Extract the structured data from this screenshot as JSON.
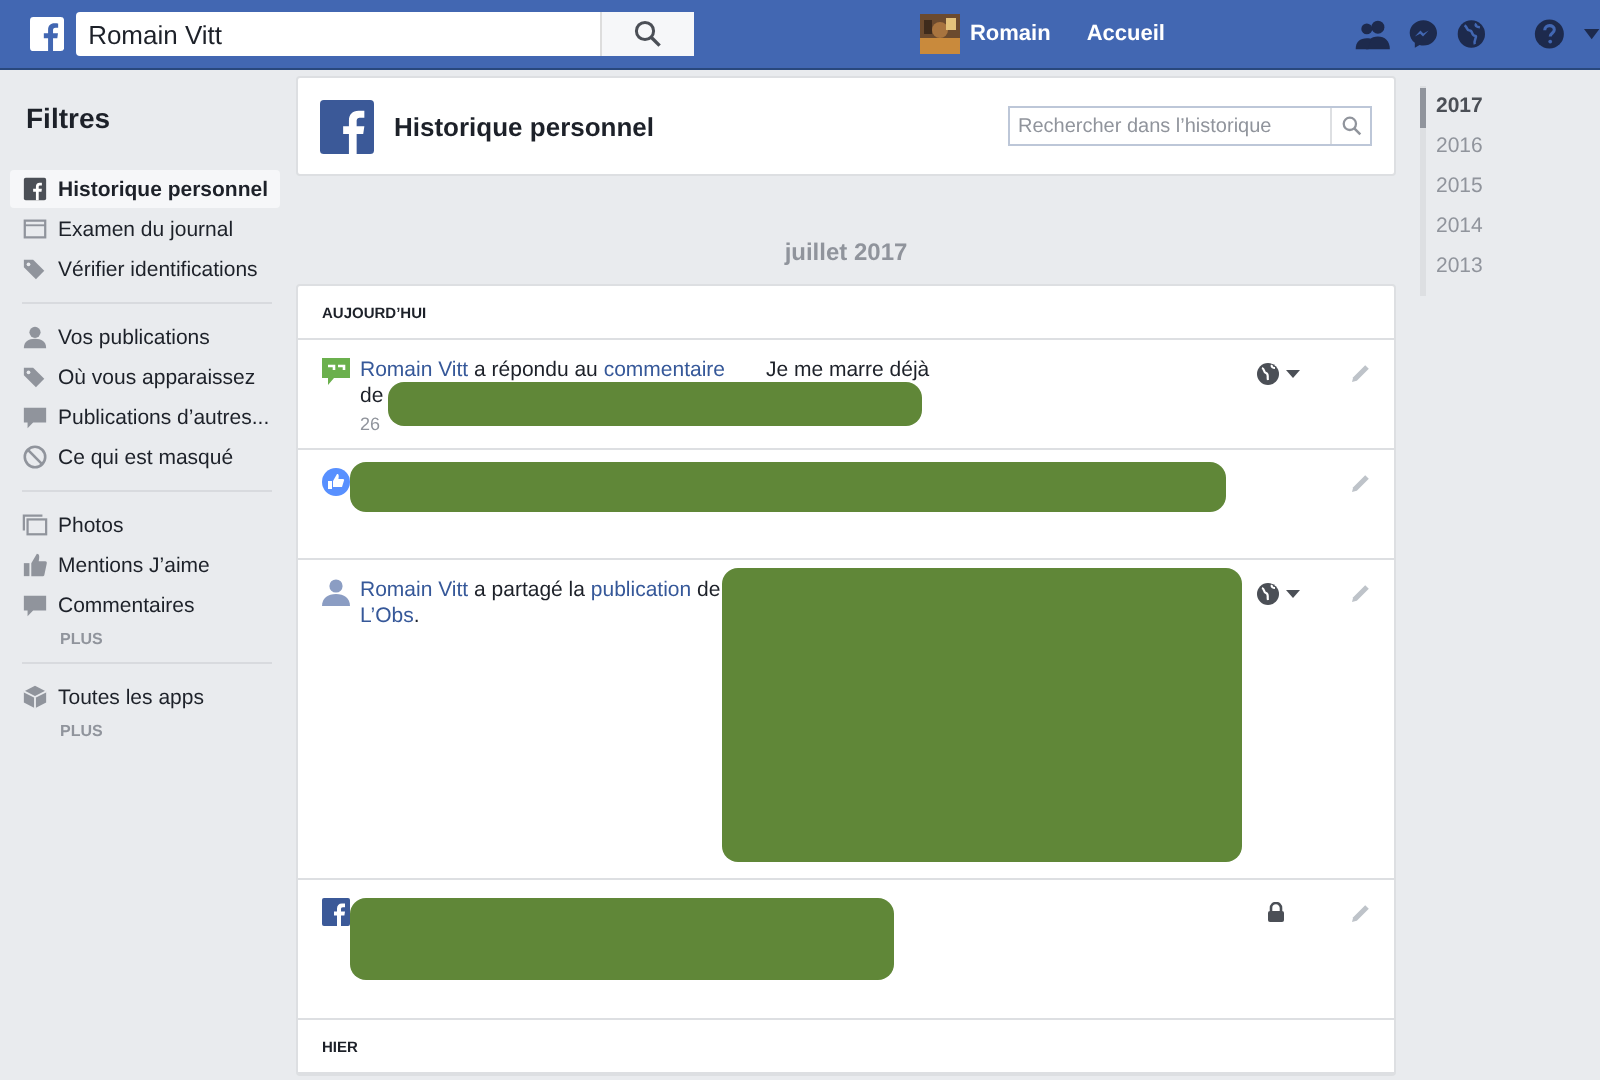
{
  "top_bar": {
    "search": {
      "value": "Romain Vitt"
    },
    "profile_name": "Romain",
    "home_link": "Accueil"
  },
  "sidebar": {
    "title": "Filtres",
    "groups": [
      {
        "items": [
          {
            "label": "Historique personnel",
            "kind": "fb",
            "selected": true
          },
          {
            "label": "Examen du journal",
            "kind": "journal",
            "selected": false
          },
          {
            "label": "Vérifier identifications",
            "kind": "tag",
            "selected": false
          }
        ]
      },
      {
        "items": [
          {
            "label": "Vos publications",
            "kind": "person",
            "selected": false
          },
          {
            "label": "Où vous apparaissez",
            "kind": "tag",
            "selected": false
          },
          {
            "label": "Publications d’autres...",
            "kind": "speech",
            "selected": false
          },
          {
            "label": "Ce qui est masqué",
            "kind": "ban",
            "selected": false
          }
        ]
      },
      {
        "items": [
          {
            "label": "Photos",
            "kind": "photos",
            "selected": false
          },
          {
            "label": "Mentions J’aime",
            "kind": "like",
            "selected": false
          },
          {
            "label": "Commentaires",
            "kind": "comment",
            "selected": false
          }
        ],
        "more": "PLUS"
      },
      {
        "items": [
          {
            "label": "Toutes les apps",
            "kind": "cube",
            "selected": false
          }
        ],
        "more": "PLUS"
      }
    ]
  },
  "header": {
    "title": "Historique personnel",
    "search": {
      "placeholder": "Rechercher dans l’historique"
    }
  },
  "month": "juillet 2017",
  "sections": [
    {
      "heading": "AUJOURD’HUI",
      "entries": [
        {
          "kind": "comment",
          "lines": [
            [
              {
                "text": "Romain Vitt",
                "link": true
              },
              {
                "text": " a répondu au ",
                "link": false
              },
              {
                "text": "commentaire",
                "link": true
              },
              {
                "text": "       Je me marre déjà",
                "link": false
              }
            ],
            [
              {
                "text": "de",
                "link": false
              }
            ]
          ],
          "date": "26",
          "privacy": {
            "kind": "public"
          },
          "redaction": {
            "kind": "line"
          }
        },
        {
          "kind": "like",
          "redaction": {
            "kind": "bar"
          }
        },
        {
          "kind": "share",
          "lines": [
            [
              {
                "text": "Romain Vitt",
                "link": true
              },
              {
                "text": " a partagé la ",
                "link": false
              },
              {
                "text": "publication",
                "link": true
              },
              {
                "text": " de",
                "link": false
              }
            ],
            [
              {
                "text": "L’Obs",
                "link": true
              },
              {
                "text": ".",
                "link": false
              }
            ]
          ],
          "privacy": {
            "kind": "public"
          },
          "redaction": {
            "kind": "block"
          }
        },
        {
          "kind": "fb",
          "privacy": {
            "kind": "only_me"
          },
          "redaction": {
            "kind": "box"
          }
        }
      ]
    },
    {
      "heading": "HIER"
    }
  ],
  "years": [
    {
      "label": "2017",
      "selected": true
    },
    {
      "label": "2016",
      "selected": false
    },
    {
      "label": "2015",
      "selected": false
    },
    {
      "label": "2014",
      "selected": false
    },
    {
      "label": "2013",
      "selected": false
    }
  ]
}
